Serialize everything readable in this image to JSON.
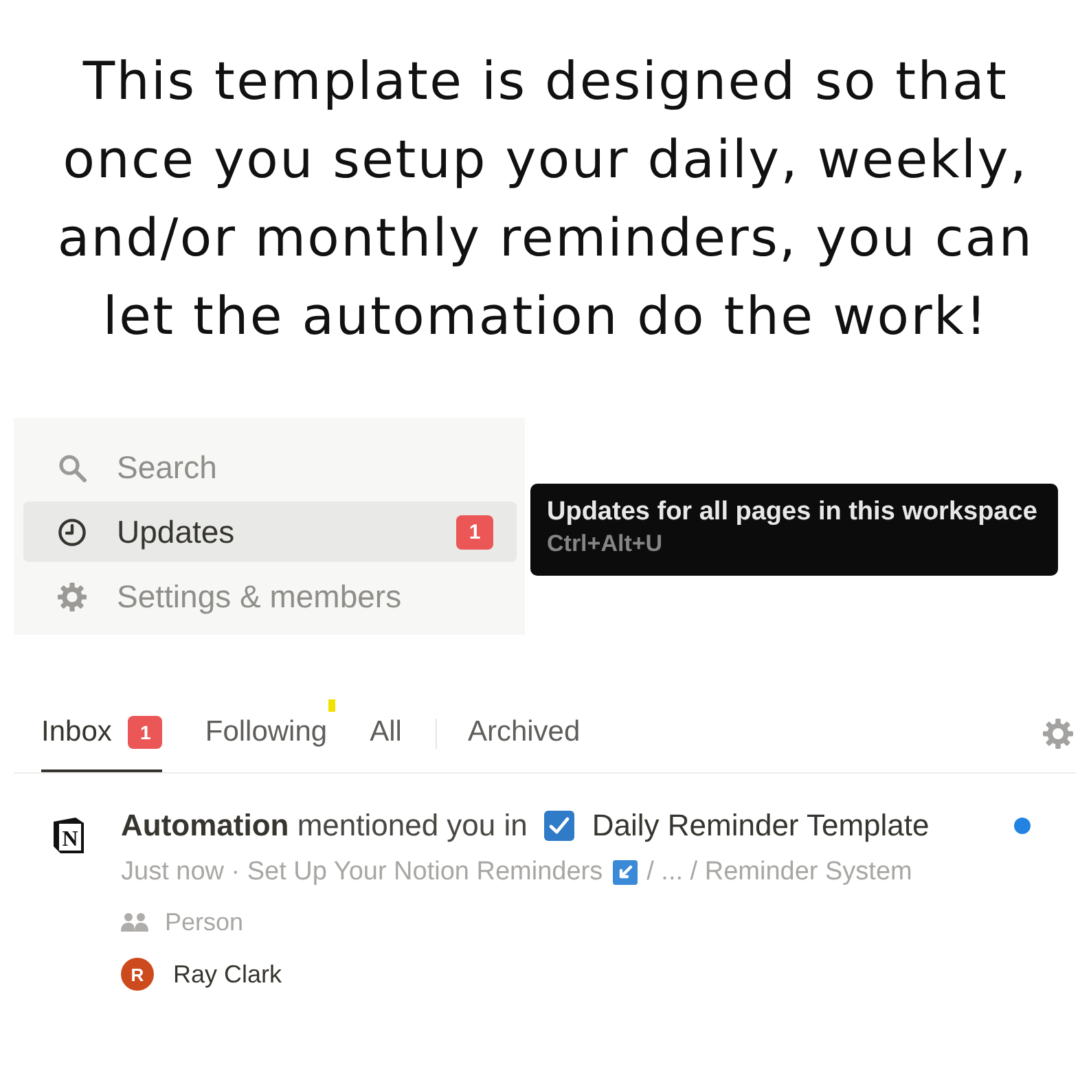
{
  "headline": "This template is designed so that\nonce you setup your daily, weekly,\nand/or monthly reminders, you can\nlet the automation do the work!",
  "sidebar": {
    "items": [
      {
        "kind": "search",
        "label": "Search",
        "selected": false
      },
      {
        "kind": "updates",
        "label": "Updates",
        "selected": true,
        "badge": "1"
      },
      {
        "kind": "settings",
        "label": "Settings & members",
        "selected": false
      }
    ]
  },
  "tooltip": {
    "title": "Updates for all pages in this workspace",
    "shortcut": "Ctrl+Alt+U"
  },
  "inbox": {
    "tabs": [
      {
        "label": "Inbox",
        "selected": true,
        "badge": "1"
      },
      {
        "label": "Following",
        "selected": false
      },
      {
        "label": "All",
        "selected": false
      },
      {
        "label": "Archived",
        "selected": false
      }
    ],
    "notifications": [
      {
        "logo_letter": "N",
        "sentence": "**Automation** mentioned you in",
        "page": "Daily Reminder Template",
        "unread": true,
        "meta": "Just now · Set Up Your Notion Reminders",
        "path": "/ ... / Reminder System",
        "property": "Person",
        "person": {
          "initial": "R",
          "name": "Ray Clark"
        }
      }
    ]
  }
}
